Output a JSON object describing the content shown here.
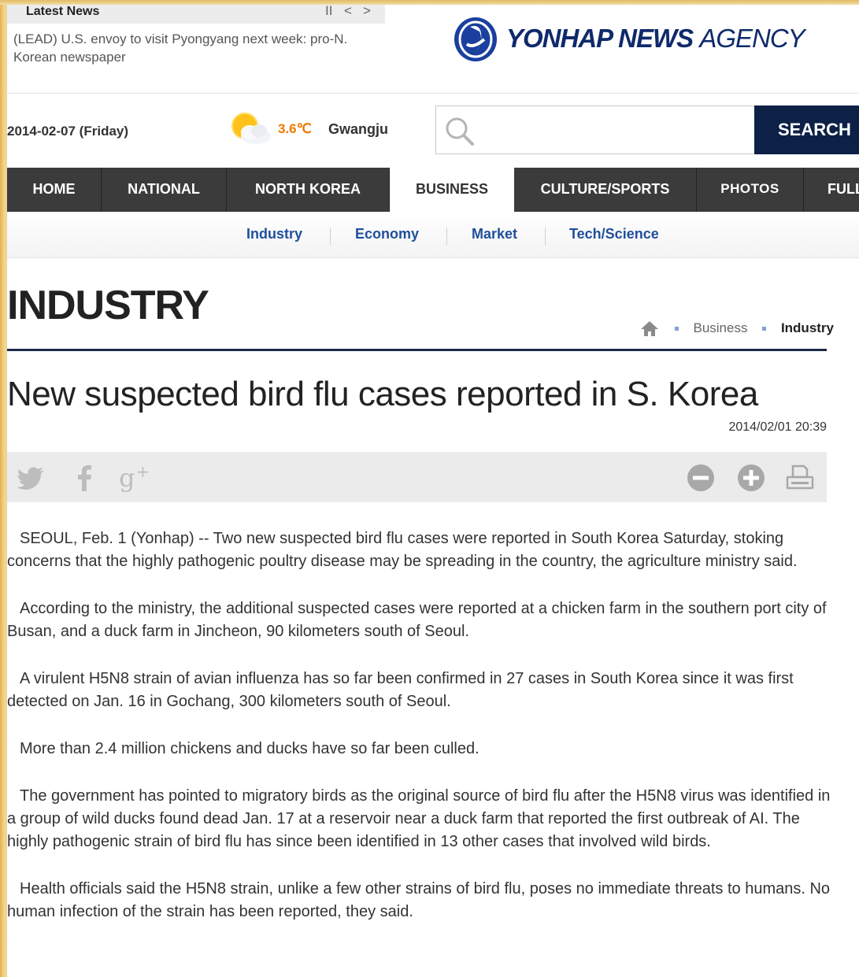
{
  "ticker": {
    "title": "Latest News",
    "controls": {
      "pause": "II",
      "prev": "<",
      "next": ">"
    },
    "headline": "(LEAD) U.S. envoy to visit Pyongyang next week: pro-N. Korean newspaper"
  },
  "logo": {
    "brand": "YONHAP NEWS",
    "suffix": "AGENCY",
    "color": "#0f2a6b"
  },
  "date": "2014-02-07 (Friday)",
  "weather": {
    "icon": "partly-cloudy-icon",
    "temperature": "3.6℃",
    "city": "Gwangju"
  },
  "search": {
    "placeholder": "",
    "value": "",
    "button_label": "SEARCH"
  },
  "nav": {
    "items": [
      {
        "label": "HOME",
        "active": false
      },
      {
        "label": "NATIONAL",
        "active": false
      },
      {
        "label": "NORTH KOREA",
        "active": false
      },
      {
        "label": "BUSINESS",
        "active": true
      },
      {
        "label": "CULTURE/SPORTS",
        "active": false
      },
      {
        "label": "PHOTOS",
        "active": false
      },
      {
        "label": "FULL",
        "active": false
      }
    ]
  },
  "subnav": {
    "items": [
      {
        "label": "Industry"
      },
      {
        "label": "Economy"
      },
      {
        "label": "Market"
      },
      {
        "label": "Tech/Science"
      }
    ]
  },
  "section": {
    "title": "INDUSTRY",
    "breadcrumb": {
      "parent": "Business",
      "current": "Industry"
    }
  },
  "article": {
    "headline": "New suspected bird flu cases reported in S. Korea",
    "timestamp": "2014/02/01 20:39",
    "share": [
      "twitter-icon",
      "facebook-icon",
      "google-plus-icon"
    ],
    "tools": [
      "zoom-out-icon",
      "zoom-in-icon",
      "print-icon"
    ],
    "paragraphs": [
      "SEOUL, Feb. 1 (Yonhap) -- Two new suspected bird flu cases were reported in South Korea Saturday, stoking concerns that the highly pathogenic poultry disease may be spreading in the country, the agriculture ministry said.",
      "According to the ministry, the additional suspected cases were reported at a chicken farm in the southern port city of Busan, and a duck farm in Jincheon, 90 kilometers south of Seoul.",
      "A virulent H5N8 strain of avian influenza has so far been confirmed in 27 cases in South Korea since it was first detected on Jan. 16 in Gochang, 300 kilometers south of Seoul.",
      "More than 2.4 million chickens and ducks have so far been culled.",
      "The government has pointed to migratory birds as the original source of bird flu after the H5N8 virus was identified in a group of wild ducks found dead Jan. 17 at a reservoir near a duck farm that reported the first outbreak of AI. The highly pathogenic strain of bird flu has since been identified in 13 other cases that involved wild birds.",
      "Health officials said the H5N8 strain, unlike a few other strains of bird flu, poses no immediate threats to humans. No human infection of the strain has been reported, they said."
    ]
  }
}
